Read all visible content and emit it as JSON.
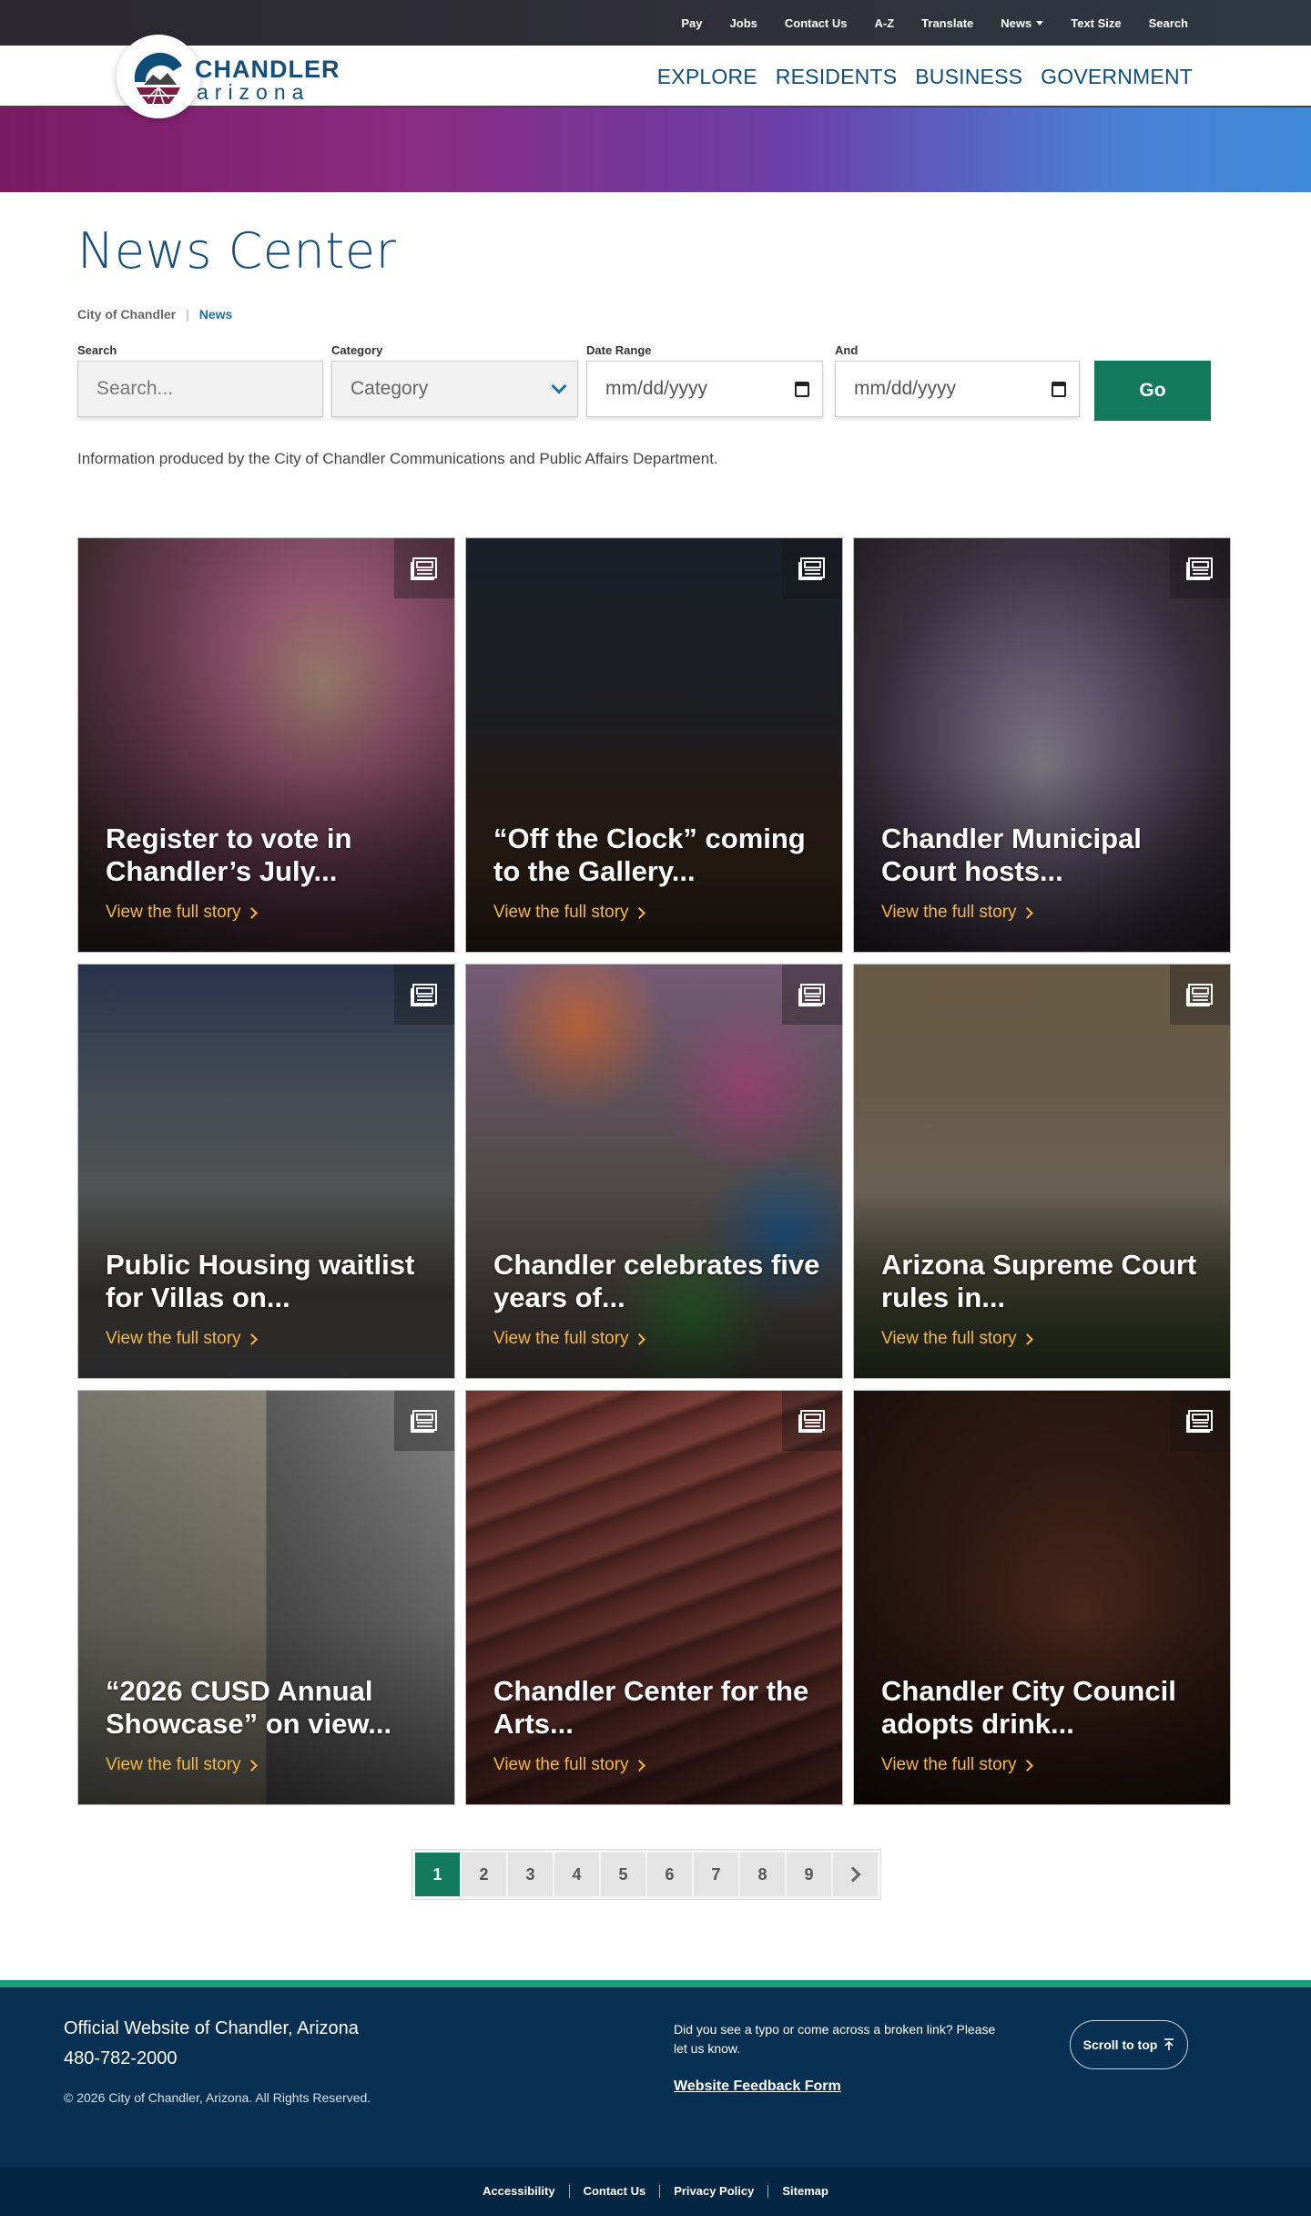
{
  "utility_nav": {
    "items": [
      "Pay",
      "Jobs",
      "Contact Us",
      "A-Z",
      "Translate",
      "News",
      "Text Size",
      "Search"
    ]
  },
  "logo": {
    "name": "CHANDLER",
    "sub": "arizona"
  },
  "main_nav": {
    "items": [
      "EXPLORE",
      "RESIDENTS",
      "BUSINESS",
      "GOVERNMENT"
    ]
  },
  "page": {
    "title": "News Center",
    "breadcrumb_home": "City of Chandler",
    "breadcrumb_current": "News"
  },
  "filters": {
    "search_label": "Search",
    "search_placeholder": "Search...",
    "category_label": "Category",
    "category_value": "Category",
    "date_label": "Date Range",
    "date_placeholder": "mm/dd/yyyy",
    "and_label": "And",
    "and_placeholder": "mm/dd/yyyy",
    "go_label": "Go"
  },
  "info_text": "Information produced by the City of Chandler Communications and Public Affairs Department.",
  "cards": [
    {
      "title": "Register to vote in Chandler’s July...",
      "link": "View the full story"
    },
    {
      "title": "“Off the Clock” coming to the Gallery...",
      "link": "View the full story"
    },
    {
      "title": "Chandler Municipal Court hosts...",
      "link": "View the full story"
    },
    {
      "title": "Public Housing waitlist for Villas on...",
      "link": "View the full story"
    },
    {
      "title": "Chandler celebrates five years of...",
      "link": "View the full story"
    },
    {
      "title": "Arizona Supreme Court rules in...",
      "link": "View the full story"
    },
    {
      "title": "“2026 CUSD Annual Showcase” on view...",
      "link": "View the full story"
    },
    {
      "title": "Chandler Center for the Arts...",
      "link": "View the full story"
    },
    {
      "title": "Chandler City Council adopts drink...",
      "link": "View the full story"
    }
  ],
  "pagination": {
    "pages": [
      "1",
      "2",
      "3",
      "4",
      "5",
      "6",
      "7",
      "8",
      "9"
    ],
    "current": "1"
  },
  "footer": {
    "site": "Official Website of Chandler, Arizona",
    "phone": "480-782-2000",
    "copyright": "© 2026 City of Chandler, Arizona. All Rights Reserved.",
    "feedback_text": "Did you see a typo or come across a broken link? Please let us know.",
    "feedback_link": "Website Feedback Form",
    "scroll_top": "Scroll to top"
  },
  "bottom_links": [
    "Accessibility",
    "Contact Us",
    "Privacy Policy",
    "Sitemap"
  ],
  "colors": {
    "brand_blue": "#16507a",
    "accent_green": "#127a5a",
    "link_gold": "#f5b740",
    "footer_navy": "#073052"
  }
}
